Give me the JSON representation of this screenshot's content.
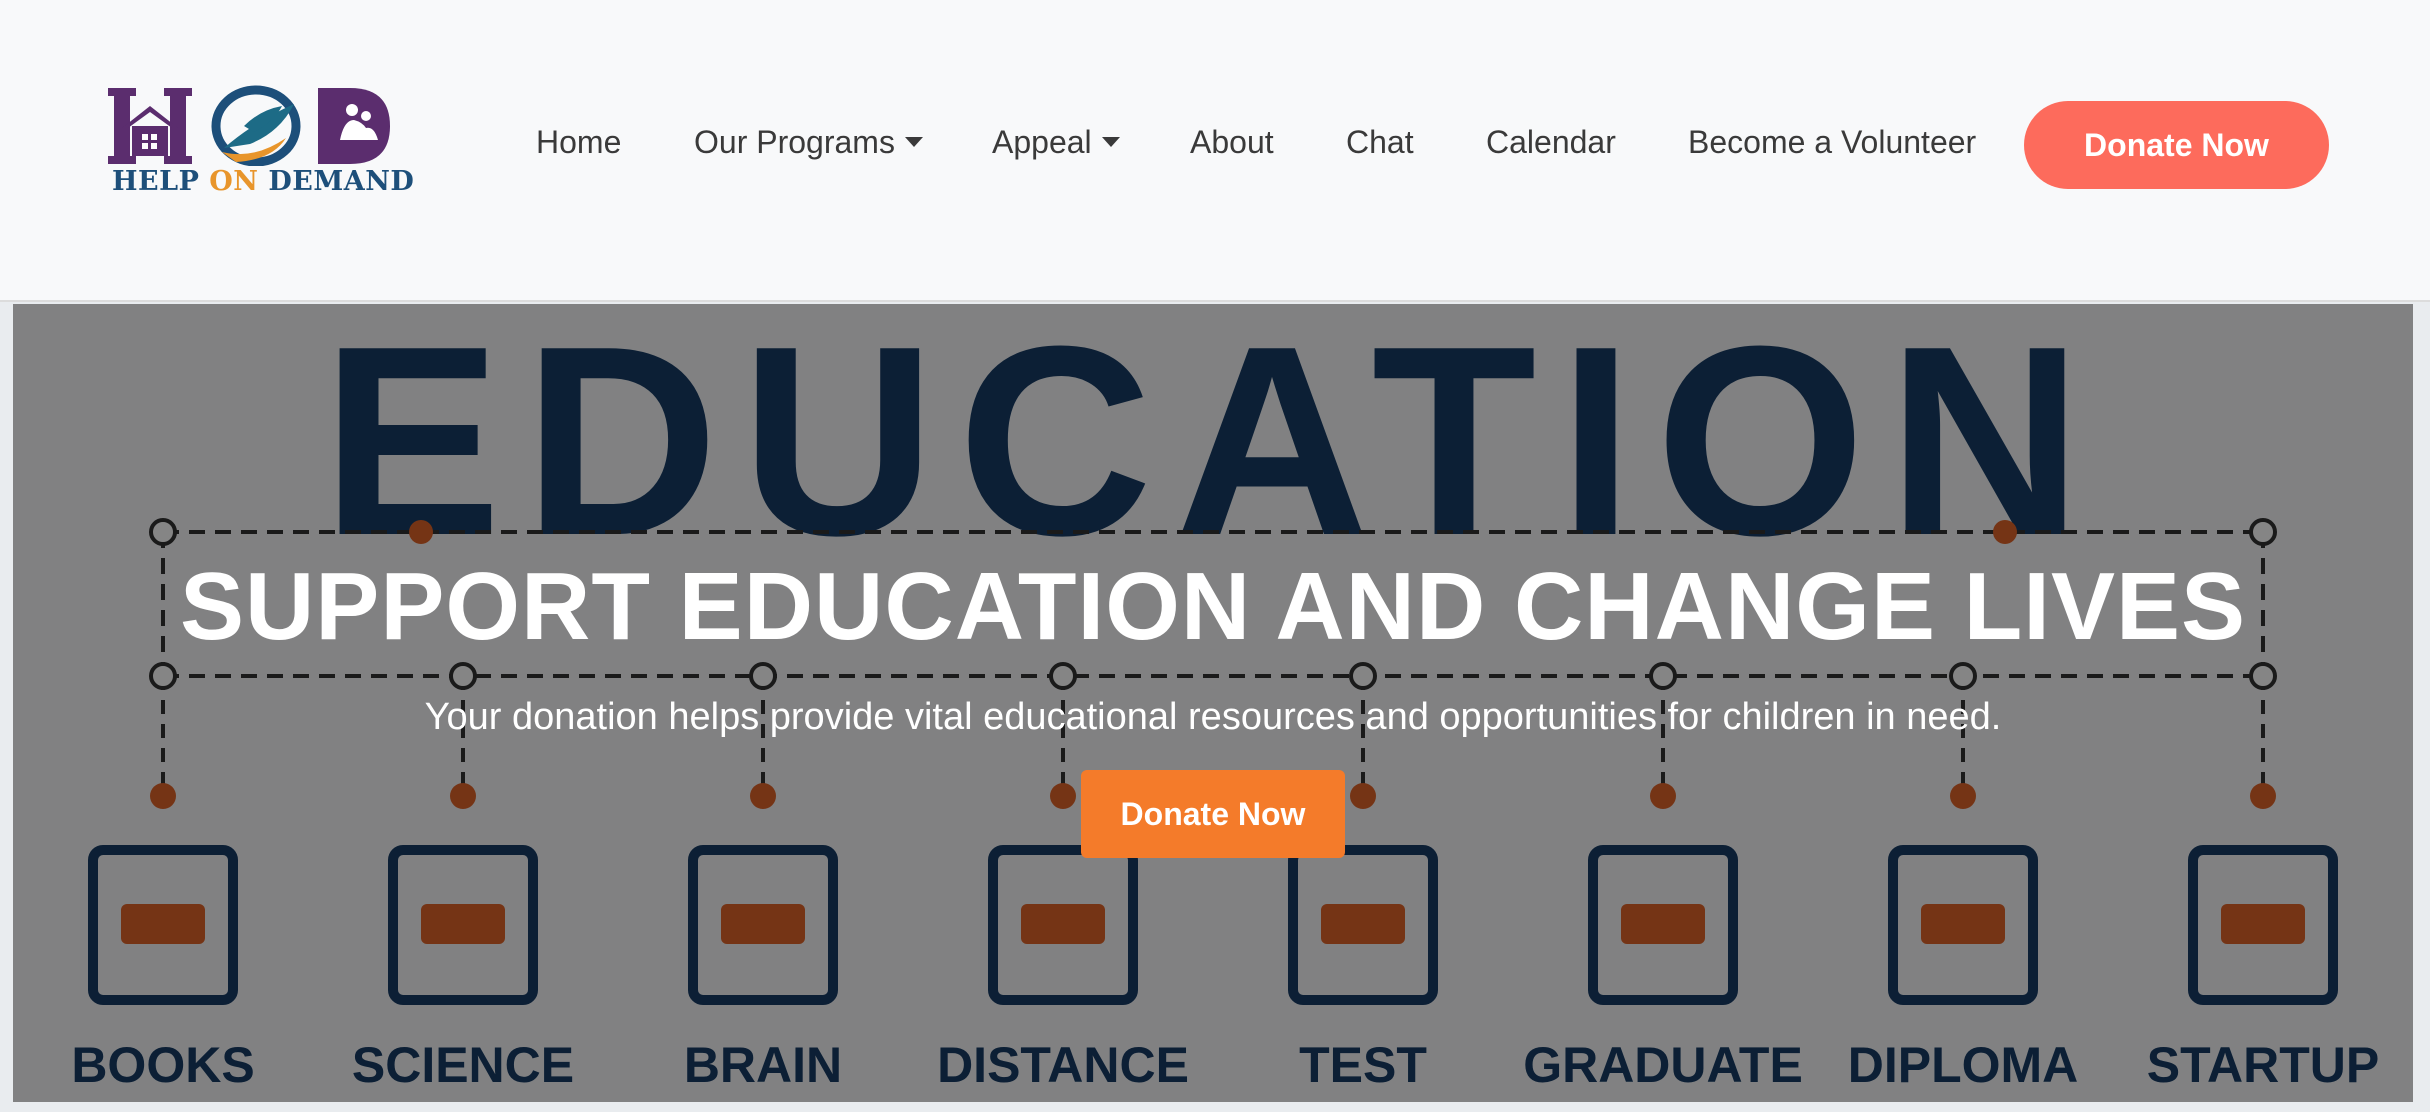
{
  "logo": {
    "brand_help": "HELP ",
    "brand_on": "ON",
    "brand_demand": " DEMAND",
    "colors": {
      "purple": "#5b2d6e",
      "orange": "#e8952b",
      "blue": "#1d4f7a"
    }
  },
  "nav": {
    "items": [
      {
        "label": "Home",
        "dropdown": false
      },
      {
        "label": "Our Programs",
        "dropdown": true
      },
      {
        "label": "Appeal",
        "dropdown": true
      },
      {
        "label": "About",
        "dropdown": false
      },
      {
        "label": "Chat",
        "dropdown": false
      },
      {
        "label": "Calendar",
        "dropdown": false
      },
      {
        "label": "Become a Volunteer",
        "dropdown": false
      }
    ],
    "donate_label": "Donate Now"
  },
  "hero": {
    "title": "SUPPORT EDUCATION AND CHANGE LIVES",
    "subtitle": "Your donation helps provide vital educational resources and opportunities for children in need.",
    "donate_label": "Donate Now",
    "image": {
      "headline": "EDUCATION",
      "icons": [
        "BOOKS",
        "SCIENCE",
        "BRAIN",
        "DISTANCE",
        "TEST",
        "GRADUATE",
        "DIPLOMA",
        "STARTUP"
      ]
    }
  },
  "colors": {
    "header_bg": "#f8f9fa",
    "header_donate": "#fd6b5c",
    "hero_donate": "#f47b2a",
    "navy": "#173c66",
    "orange": "#e0642a"
  }
}
